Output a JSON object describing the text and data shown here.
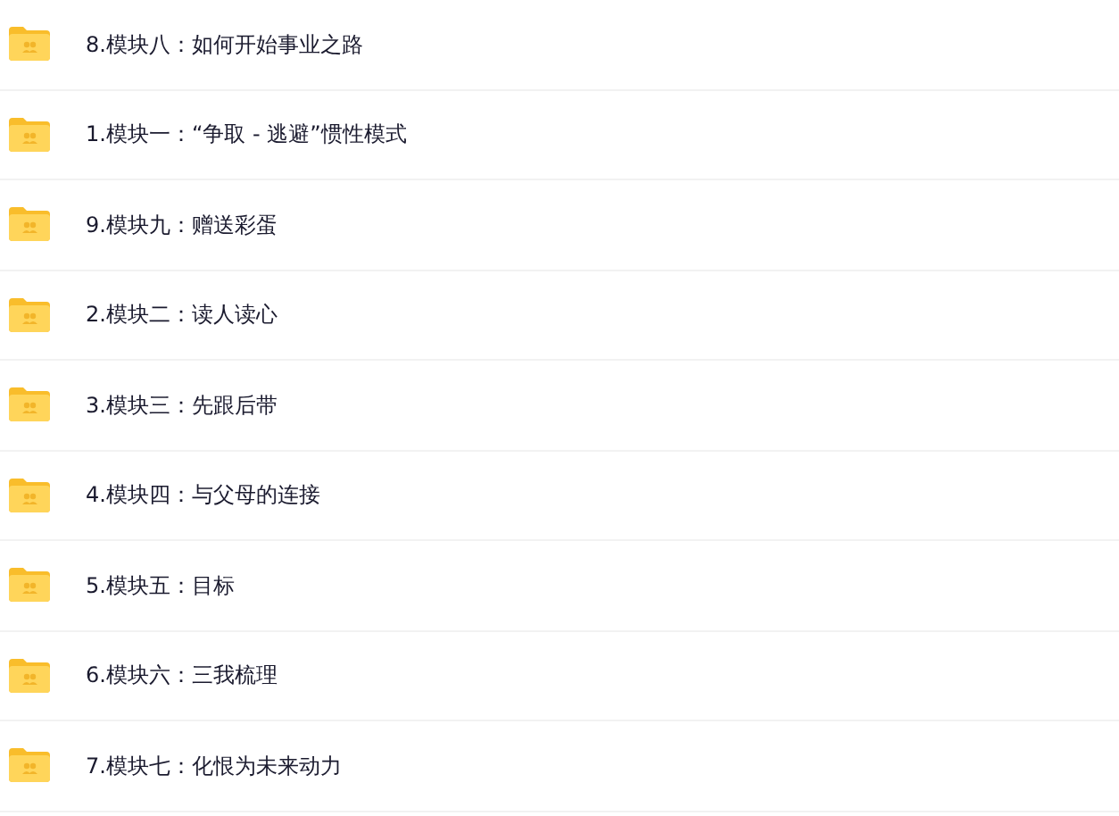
{
  "files": [
    {
      "name": "8.模块八：如何开始事业之路"
    },
    {
      "name": "1.模块一：“争取 - 逃避”惯性模式"
    },
    {
      "name": "9.模块九：赠送彩蛋"
    },
    {
      "name": "2.模块二：读人读心"
    },
    {
      "name": "3.模块三：先跟后带"
    },
    {
      "name": "4.模块四：与父母的连接"
    },
    {
      "name": "5.模块五：目标"
    },
    {
      "name": "6.模块六：三我梳理"
    },
    {
      "name": "7.模块七：化恨为未来动力"
    }
  ]
}
